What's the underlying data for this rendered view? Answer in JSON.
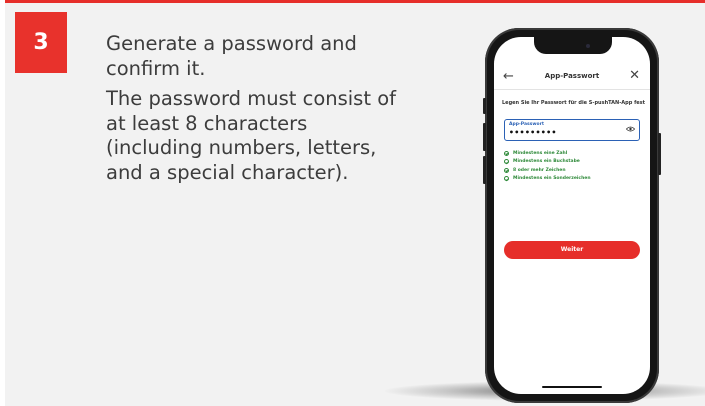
{
  "step": {
    "number": "3"
  },
  "instructions": {
    "line1": "Generate a password and confirm it.",
    "line2": "The password must consist of at least 8 characters (including numbers, letters, and a special character)."
  },
  "colors": {
    "accent": "#e62e2a",
    "success": "#2f8a3a",
    "field_border": "#2b61b5"
  },
  "app": {
    "title": "App-Passwort",
    "back_icon": "arrow-left-icon",
    "close_icon": "close-icon",
    "prompt": "Legen Sie Ihr Passwort für die S-pushTAN-App fest",
    "password_field": {
      "label": "App-Passwort",
      "value": "•••••••••"
    },
    "rules": [
      "Mindestens eine Zahl",
      "Mindestens ein Buchstabe",
      "8 oder mehr Zeichen",
      "Mindestens ein Sonderzeichen"
    ],
    "continue_label": "Weiter"
  }
}
